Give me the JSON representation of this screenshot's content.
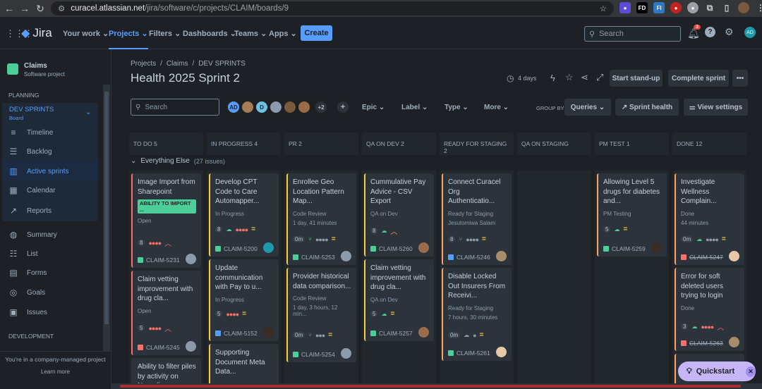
{
  "browser": {
    "url_host": "curacel.atlassian.net",
    "url_path": "/jira/software/c/projects/CLAIM/boards/9"
  },
  "topnav": {
    "app": "Jira",
    "items": [
      "Your work",
      "Projects",
      "Filters",
      "Dashboards",
      "Teams",
      "Apps"
    ],
    "create": "Create",
    "search_placeholder": "Search",
    "notif_count": "3",
    "user_initials": "AD"
  },
  "sidebar": {
    "project_name": "Claims",
    "project_type": "Software project",
    "planning_label": "PLANNING",
    "board_name": "DEV SPRINTS",
    "board_sub": "Board",
    "items": [
      "Timeline",
      "Backlog",
      "Active sprints",
      "Calendar",
      "Reports",
      "Summary",
      "List",
      "Forms",
      "Goals",
      "Issues"
    ],
    "development_label": "DEVELOPMENT",
    "footer_text": "You're in a company-managed project",
    "footer_link": "Learn more"
  },
  "breadcrumb": [
    "Projects",
    "Claims",
    "DEV SPRINTS"
  ],
  "title": "Health 2025 Sprint 2",
  "header": {
    "days": "4 days",
    "standup": "Start stand-up",
    "complete": "Complete sprint"
  },
  "toolbar": {
    "search_placeholder": "Search",
    "more_avatars": "+2",
    "epic": "Epic",
    "label": "Label",
    "type": "Type",
    "more": "More",
    "group_by": "GROUP BY",
    "queries": "Queries",
    "sprint_health": "Sprint health",
    "view_settings": "View settings"
  },
  "avatars": [
    {
      "initials": "AD",
      "color": "#579dff"
    },
    {
      "initials": "",
      "color": "#a47e5a"
    },
    {
      "initials": "D",
      "color": "#6cc3e0"
    },
    {
      "initials": "",
      "color": "#8c9bab"
    },
    {
      "initials": "",
      "color": "#7a5a3c"
    },
    {
      "initials": "",
      "color": "#9b6b4a"
    }
  ],
  "swimlane": {
    "label": "Everything Else",
    "count": "(27 issues)"
  },
  "columns": [
    "TO DO 5",
    "IN PROGRESS 4",
    "PR 2",
    "QA ON DEV 2",
    "READY FOR STAGING 2",
    "QA ON STAGING",
    "PM TEST 1",
    "DONE 12"
  ],
  "cards": [
    {
      "col": 0,
      "title": "Image Import from Sharepoint",
      "lozenge": "ABILITY TO IMPORT ...",
      "status": "Open",
      "count": "8",
      "key": "CLAIM-5231"
    },
    {
      "col": 0,
      "title": "Claim vetting improvement with drug cla...",
      "status": "Open",
      "count": "5",
      "key": "CLAIM-5245"
    },
    {
      "col": 0,
      "title": "Ability to filter piles by activity on Nova (i.e..."
    },
    {
      "col": 1,
      "title": "Develop CPT Code to Care Automapper...",
      "status": "In Progress",
      "count": "8",
      "key": "CLAIM-5200"
    },
    {
      "col": 1,
      "title": "Update communication with Pay to u...",
      "status": "In Progress",
      "count": "5",
      "key": "CLAIM-5152"
    },
    {
      "col": 1,
      "title": "Supporting Document Meta Data..."
    },
    {
      "col": 2,
      "title": "Enrollee Geo Location Pattern Map...",
      "status": "Code Review",
      "meta": "1 day, 41 minutes",
      "count": "0m",
      "key": "CLAIM-5253"
    },
    {
      "col": 2,
      "title": "Provider historical data comparison...",
      "status": "Code Review",
      "meta": "1 day, 3 hours, 12 min...",
      "count": "0m",
      "key": "CLAIM-5254"
    },
    {
      "col": 3,
      "title": "Cummulative Pay Advice - CSV Export",
      "status": "QA on Dev",
      "count": "8",
      "key": "CLAIM-5260"
    },
    {
      "col": 3,
      "title": "Claim vetting improvement with drug cla...",
      "status": "QA on Dev",
      "count": "5",
      "key": "CLAIM-5257"
    },
    {
      "col": 4,
      "title": "Connect Curacel Org Authenticatio...",
      "status": "Ready for Staging",
      "meta": "Jesutomiwa Salam",
      "count": "8",
      "key": "CLAIM-5246"
    },
    {
      "col": 4,
      "title": "Disable Locked Out Insurers From Receivi...",
      "status": "Ready for Staging",
      "meta": "7 hours, 30 minutes",
      "count": "0m",
      "key": "CLAIM-5261"
    },
    {
      "col": 6,
      "title": "Allowing Level 5 drugs for diabetes and...",
      "status": "PM Testing",
      "count": "5",
      "key": "CLAIM-5259"
    },
    {
      "col": 7,
      "title": "Investigate Wellness Complain...",
      "status": "Done",
      "meta": "44 minutes",
      "count": "0m",
      "key": "CLAIM-5247"
    },
    {
      "col": 7,
      "title": "Error for soft deleted users trying to login",
      "status": "Done",
      "count": "3",
      "key": "CLAIM-5263"
    }
  ],
  "quickstart": "Quickstart"
}
